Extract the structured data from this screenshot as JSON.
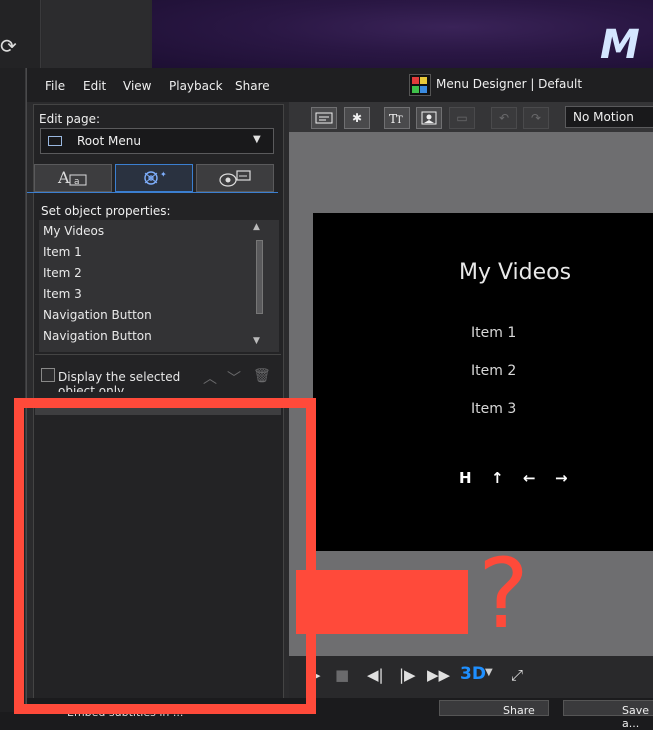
{
  "menubar": [
    "File",
    "Edit",
    "View",
    "Playback",
    "Share"
  ],
  "window": {
    "title": "Menu Designer | Default"
  },
  "left_panel": {
    "edit_page_label": "Edit page:",
    "page_select_value": "Root Menu",
    "tabs": [
      {
        "icon": "text-properties-icon"
      },
      {
        "icon": "effects-icon"
      },
      {
        "icon": "navigation-link-icon"
      }
    ],
    "properties_label": "Set object properties:",
    "objects": [
      "My Videos",
      "Item 1",
      "Item 2",
      "Item 3",
      "Navigation Button",
      "Navigation Button"
    ],
    "display_selected_label": "Display the selected object only"
  },
  "toolbar": {
    "tools": [
      "add-button-icon",
      "add-effect-icon",
      "add-text-icon",
      "add-image-icon",
      "align-icon",
      "undo-icon",
      "redo-icon"
    ],
    "motion_value": "No Motion"
  },
  "preview": {
    "title": "My Videos",
    "items": [
      "Item 1",
      "Item 2",
      "Item 3"
    ],
    "nav_buttons": [
      "H",
      "↑",
      "←",
      "→"
    ]
  },
  "playback": {
    "controls": [
      "play-icon",
      "stop-icon",
      "previous-icon",
      "next-icon",
      "fast-forward-icon"
    ],
    "threed_label": "3D",
    "fullscreen_icon": "fullscreen-icon"
  },
  "status": {
    "text": "Embed subtitles in ...",
    "share_label": "Share",
    "save_label": "Save a..."
  },
  "annotation": {
    "question_mark": "?",
    "color": "#ff4a3a"
  },
  "colors": {
    "accent": "#3b7fd0",
    "threed_blue": "#1e8fff",
    "preview_gray": "#6e6e70",
    "preview_black": "#000000"
  }
}
